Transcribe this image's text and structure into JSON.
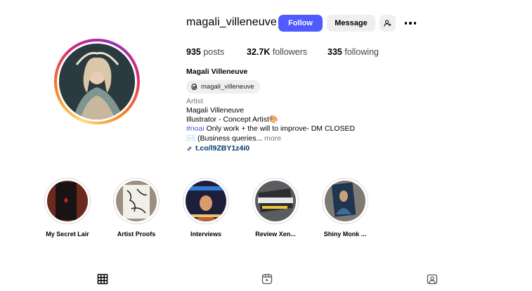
{
  "profile": {
    "username": "magali_villeneuve",
    "follow_label": "Follow",
    "message_label": "Message",
    "stats": {
      "posts_count": "935",
      "posts_label": "posts",
      "followers_count": "32.7K",
      "followers_label": "followers",
      "following_count": "335",
      "following_label": "following"
    },
    "full_name": "Magali Villeneuve",
    "threads_handle": "magali_villeneuve",
    "category": "Artist",
    "bio_line1": "Magali Villeneuve",
    "bio_line2": "Illustrator - Concept Artist🎨",
    "bio_hashtag": "#noai",
    "bio_line3_rest": " Only work + the will to improve- DM CLOSED",
    "bio_line4": "✉️ (Business queries...",
    "bio_more": " more",
    "link_text": "t.co/l9ZBY1z4i0"
  },
  "highlights": [
    {
      "label": "My Secret Lair"
    },
    {
      "label": "Artist Proofs"
    },
    {
      "label": "Interviews"
    },
    {
      "label": "Review Xen..."
    },
    {
      "label": "Shiny Monk ..."
    }
  ],
  "tabs": [
    "grid-icon",
    "reels-icon",
    "tagged-icon"
  ],
  "colors": {
    "follow": "#4f5bff",
    "secondary_button": "#efefef",
    "hashtag": "#4a5bd8",
    "link": "#00376b"
  }
}
